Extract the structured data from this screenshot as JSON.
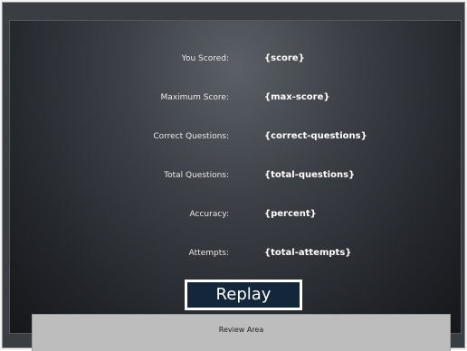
{
  "results": {
    "rows": [
      {
        "label": "You Scored:",
        "value": "{score}"
      },
      {
        "label": "Maximum Score:",
        "value": "{max-score}"
      },
      {
        "label": "Correct Questions:",
        "value": "{correct-questions}"
      },
      {
        "label": "Total Questions:",
        "value": "{total-questions}"
      },
      {
        "label": "Accuracy:",
        "value": "{percent}"
      },
      {
        "label": "Attempts:",
        "value": "{total-attempts}"
      }
    ]
  },
  "actions": {
    "replay_label": "Replay"
  },
  "review": {
    "label": "Review Area"
  },
  "colors": {
    "panel_dark": "#22252a",
    "button_bg": "#14263a",
    "button_border": "#ffffff",
    "review_bg": "#bdbdbd"
  }
}
